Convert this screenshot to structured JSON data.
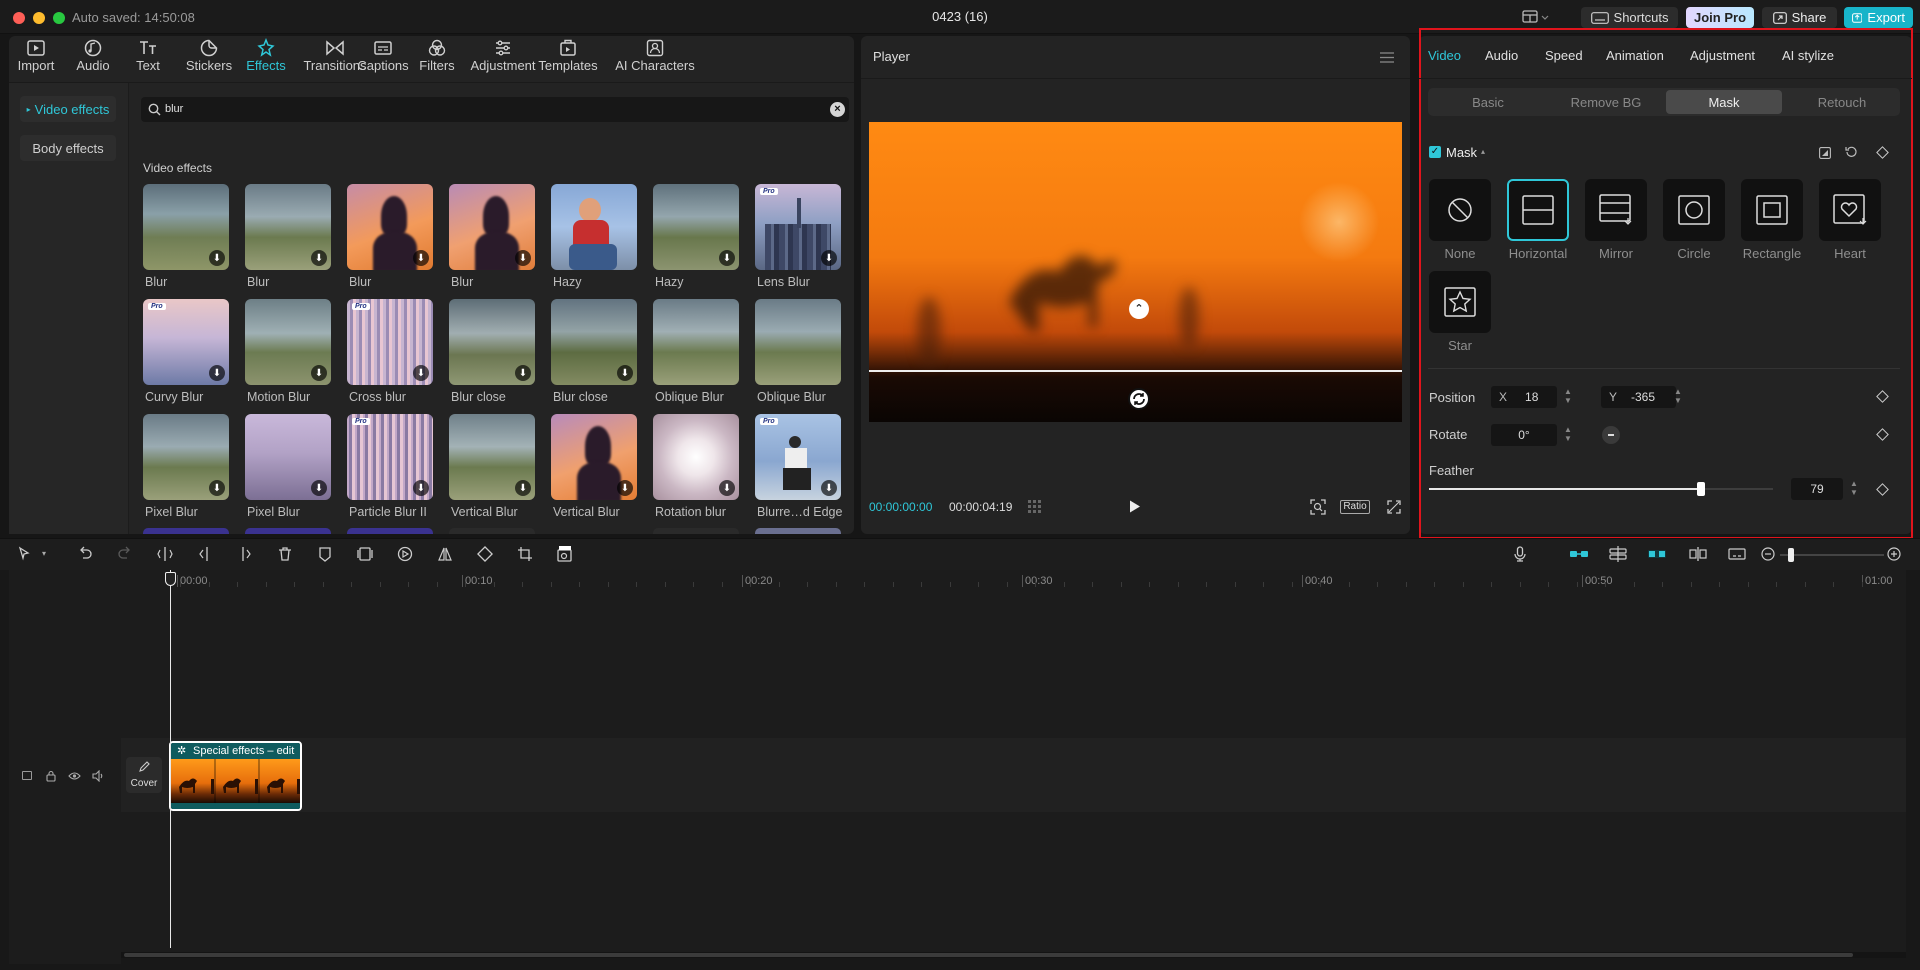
{
  "app": {
    "autosave": "Auto saved: 14:50:08",
    "project_title": "0423 (16)",
    "shortcuts_label": "Shortcuts",
    "join_pro_label": "Join Pro",
    "share_label": "Share",
    "export_label": "Export",
    "accent": "#2fc7d8"
  },
  "toolbar": {
    "tabs": [
      {
        "label": "Import",
        "icon": "import-icon"
      },
      {
        "label": "Audio",
        "icon": "audio-icon"
      },
      {
        "label": "Text",
        "icon": "text-icon"
      },
      {
        "label": "Stickers",
        "icon": "stickers-icon"
      },
      {
        "label": "Effects",
        "icon": "effects-icon"
      },
      {
        "label": "Transitions",
        "icon": "transitions-icon"
      },
      {
        "label": "Captions",
        "icon": "captions-icon"
      },
      {
        "label": "Filters",
        "icon": "filters-icon"
      },
      {
        "label": "Adjustment",
        "icon": "adjustment-icon"
      },
      {
        "label": "Templates",
        "icon": "templates-icon"
      },
      {
        "label": "AI Characters",
        "icon": "ai-characters-icon"
      }
    ],
    "active": "Effects"
  },
  "effects": {
    "side": {
      "video_effects": "Video effects",
      "body_effects": "Body effects"
    },
    "search_value": "blur",
    "section_title": "Video effects",
    "items": [
      {
        "label": "Blur"
      },
      {
        "label": "Blur"
      },
      {
        "label": "Blur"
      },
      {
        "label": "Blur"
      },
      {
        "label": "Hazy"
      },
      {
        "label": "Hazy"
      },
      {
        "label": "Lens Blur"
      },
      {
        "label": "Curvy Blur"
      },
      {
        "label": "Motion Blur"
      },
      {
        "label": "Cross blur"
      },
      {
        "label": "Blur close"
      },
      {
        "label": "Blur close"
      },
      {
        "label": "Oblique Blur"
      },
      {
        "label": "Oblique Blur"
      },
      {
        "label": "Pixel Blur"
      },
      {
        "label": "Pixel Blur"
      },
      {
        "label": "Particle Blur II"
      },
      {
        "label": "Vertical Blur"
      },
      {
        "label": "Vertical Blur"
      },
      {
        "label": "Rotation blur"
      },
      {
        "label": "Blurre…d Edge"
      }
    ]
  },
  "player": {
    "title": "Player",
    "current_time": "00:00:00:00",
    "total_time": "00:00:04:19",
    "ratio_label": "Ratio"
  },
  "inspector": {
    "tabs": [
      "Video",
      "Audio",
      "Speed",
      "Animation",
      "Adjustment",
      "AI stylize"
    ],
    "active_tab": "Video",
    "subtabs": [
      "Basic",
      "Remove BG",
      "Mask",
      "Retouch"
    ],
    "active_subtab": "Mask",
    "mask_title": "Mask",
    "masks": [
      {
        "label": "None",
        "icon": "none-mask-icon"
      },
      {
        "label": "Horizontal",
        "icon": "horizontal-mask-icon"
      },
      {
        "label": "Mirror",
        "icon": "mirror-mask-icon"
      },
      {
        "label": "Circle",
        "icon": "circle-mask-icon"
      },
      {
        "label": "Rectangle",
        "icon": "rectangle-mask-icon"
      },
      {
        "label": "Heart",
        "icon": "heart-mask-icon"
      },
      {
        "label": "Star",
        "icon": "star-mask-icon"
      }
    ],
    "selected_mask": "Horizontal",
    "position_label": "Position",
    "x_label": "X",
    "x_value": "18",
    "y_label": "Y",
    "y_value": "-365",
    "rotate_label": "Rotate",
    "rotate_value": "0°",
    "feather_label": "Feather",
    "feather_value": "79",
    "feather_fraction": 0.79
  },
  "timeline": {
    "ticks": [
      "00:00",
      "00:10",
      "00:20",
      "00:30",
      "00:40",
      "00:50",
      "01:00"
    ],
    "clip_label": "Special effects – edit",
    "cover_label": "Cover"
  }
}
